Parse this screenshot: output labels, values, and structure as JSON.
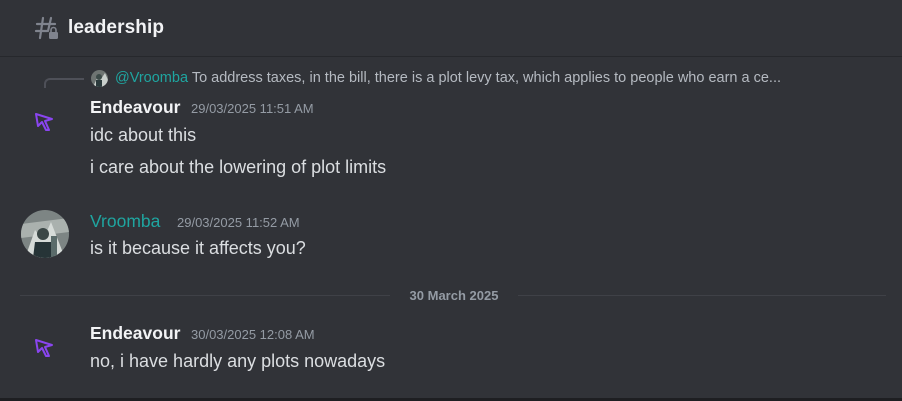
{
  "channel": {
    "name": "leadership",
    "icon": "hash-lock-icon"
  },
  "reply": {
    "mention": "@Vroomba",
    "preview": "To address taxes, in the bill, there is a plot levy tax, which applies to people who earn a ce..."
  },
  "messages": [
    {
      "author": "Endeavour",
      "timestamp": "29/03/2025 11:51 AM",
      "lines": [
        "idc about this",
        "i care about the lowering of plot limits"
      ]
    },
    {
      "author": "Vroomba",
      "timestamp": "29/03/2025 11:52 AM",
      "lines": [
        "is it because it affects you?"
      ]
    },
    {
      "author": "Endeavour",
      "timestamp": "30/03/2025 12:08 AM",
      "lines": [
        "no, i have hardly any plots nowadays"
      ]
    }
  ],
  "date_divider": "30 March 2025",
  "colors": {
    "background": "#313338",
    "mention": "#1fa5a0",
    "bot_avatar": "#7b3fe4"
  }
}
